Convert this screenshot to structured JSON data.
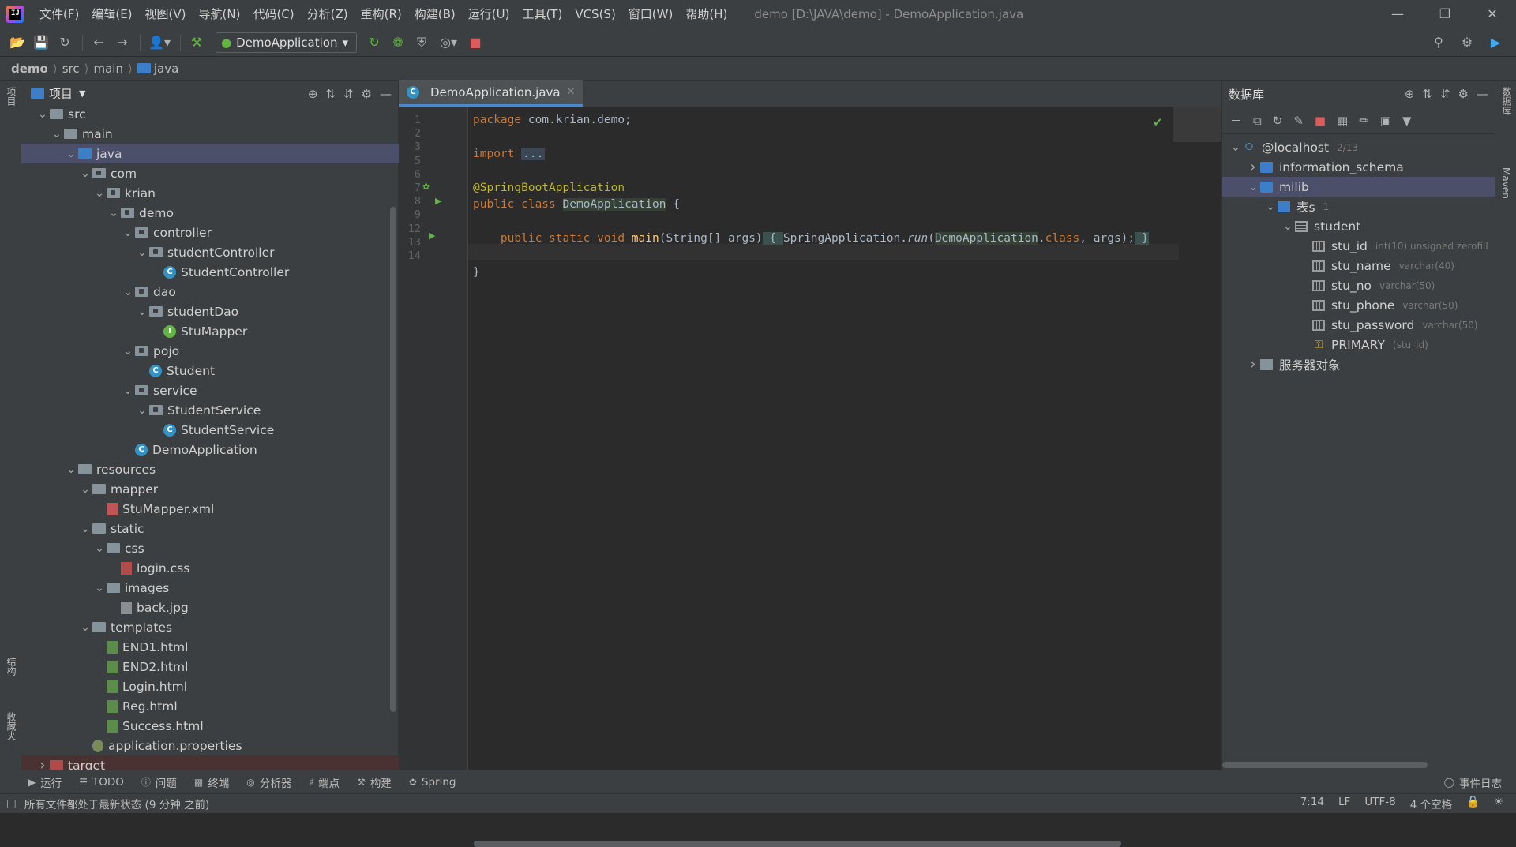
{
  "app": {
    "logo_text": "IJ",
    "menus": [
      "文件(F)",
      "编辑(E)",
      "视图(V)",
      "导航(N)",
      "代码(C)",
      "分析(Z)",
      "重构(R)",
      "构建(B)",
      "运行(U)",
      "工具(T)",
      "VCS(S)",
      "窗口(W)",
      "帮助(H)"
    ],
    "window_title": "demo [D:\\JAVA\\demo] - DemoApplication.java",
    "win_controls": {
      "minimize": "—",
      "restore": "❐",
      "close": "✕"
    }
  },
  "toolbar": {
    "run_config": "DemoApplication"
  },
  "breadcrumb": [
    "demo",
    "src",
    "main",
    "java"
  ],
  "left_stripe": {
    "project_tab": "项目",
    "structure_tab": "结构",
    "favorites_tab": "收藏夹"
  },
  "right_stripe": {
    "database_tab": "数据库",
    "maven_tab": "Maven"
  },
  "project_panel": {
    "title": "项目",
    "tree": [
      {
        "label": "src",
        "depth": 1,
        "expanded": true,
        "icon": "folder"
      },
      {
        "label": "main",
        "depth": 2,
        "expanded": true,
        "icon": "folder"
      },
      {
        "label": "java",
        "depth": 3,
        "expanded": true,
        "icon": "folder-blue",
        "selected": true
      },
      {
        "label": "com",
        "depth": 4,
        "expanded": true,
        "icon": "package"
      },
      {
        "label": "krian",
        "depth": 5,
        "expanded": true,
        "icon": "package"
      },
      {
        "label": "demo",
        "depth": 6,
        "expanded": true,
        "icon": "package"
      },
      {
        "label": "controller",
        "depth": 7,
        "expanded": true,
        "icon": "package"
      },
      {
        "label": "studentController",
        "depth": 8,
        "expanded": true,
        "icon": "package"
      },
      {
        "label": "StudentController",
        "depth": 9,
        "icon": "class"
      },
      {
        "label": "dao",
        "depth": 7,
        "expanded": true,
        "icon": "package"
      },
      {
        "label": "studentDao",
        "depth": 8,
        "expanded": true,
        "icon": "package"
      },
      {
        "label": "StuMapper",
        "depth": 9,
        "icon": "interface"
      },
      {
        "label": "pojo",
        "depth": 7,
        "expanded": true,
        "icon": "package"
      },
      {
        "label": "Student",
        "depth": 8,
        "icon": "class"
      },
      {
        "label": "service",
        "depth": 7,
        "expanded": true,
        "icon": "package"
      },
      {
        "label": "StudentService",
        "depth": 8,
        "expanded": true,
        "icon": "package"
      },
      {
        "label": "StudentService",
        "depth": 9,
        "icon": "class"
      },
      {
        "label": "DemoApplication",
        "depth": 7,
        "icon": "spring-class"
      },
      {
        "label": "resources",
        "depth": 3,
        "expanded": true,
        "icon": "folder-res"
      },
      {
        "label": "mapper",
        "depth": 4,
        "expanded": true,
        "icon": "folder"
      },
      {
        "label": "StuMapper.xml",
        "depth": 5,
        "icon": "xml"
      },
      {
        "label": "static",
        "depth": 4,
        "expanded": true,
        "icon": "folder"
      },
      {
        "label": "css",
        "depth": 5,
        "expanded": true,
        "icon": "folder"
      },
      {
        "label": "login.css",
        "depth": 6,
        "icon": "css"
      },
      {
        "label": "images",
        "depth": 5,
        "expanded": true,
        "icon": "folder"
      },
      {
        "label": "back.jpg",
        "depth": 6,
        "icon": "img"
      },
      {
        "label": "templates",
        "depth": 4,
        "expanded": true,
        "icon": "folder"
      },
      {
        "label": "END1.html",
        "depth": 5,
        "icon": "html"
      },
      {
        "label": "END2.html",
        "depth": 5,
        "icon": "html"
      },
      {
        "label": "Login.html",
        "depth": 5,
        "icon": "html"
      },
      {
        "label": "Reg.html",
        "depth": 5,
        "icon": "html"
      },
      {
        "label": "Success.html",
        "depth": 5,
        "icon": "html"
      },
      {
        "label": "application.properties",
        "depth": 4,
        "icon": "props"
      },
      {
        "label": "target",
        "depth": 1,
        "expanded": false,
        "icon": "folder-excluded",
        "excluded": true
      }
    ]
  },
  "editor": {
    "tab_label": "DemoApplication.java",
    "line_numbers": [
      "1",
      "2",
      "3",
      "5",
      "6",
      "7",
      "8",
      "9",
      "12",
      "13",
      "14"
    ]
  },
  "database_panel": {
    "title": "数据库",
    "tree": [
      {
        "label": "@localhost",
        "meta": "2/13",
        "depth": 0,
        "expanded": true,
        "icon": "host"
      },
      {
        "label": "information_schema",
        "meta": "",
        "depth": 1,
        "expanded": false,
        "icon": "schema"
      },
      {
        "label": "milib",
        "meta": "",
        "depth": 1,
        "expanded": true,
        "icon": "schema",
        "selected": true
      },
      {
        "label": "表s",
        "meta": "1",
        "depth": 2,
        "expanded": true,
        "icon": "folderb"
      },
      {
        "label": "student",
        "meta": "",
        "depth": 3,
        "expanded": true,
        "icon": "table"
      },
      {
        "label": "stu_id",
        "meta": "int(10) unsigned zerofill",
        "depth": 4,
        "icon": "col"
      },
      {
        "label": "stu_name",
        "meta": "varchar(40)",
        "depth": 4,
        "icon": "col"
      },
      {
        "label": "stu_no",
        "meta": "varchar(50)",
        "depth": 4,
        "icon": "col"
      },
      {
        "label": "stu_phone",
        "meta": "varchar(50)",
        "depth": 4,
        "icon": "col"
      },
      {
        "label": "stu_password",
        "meta": "varchar(50)",
        "depth": 4,
        "icon": "col"
      },
      {
        "label": "PRIMARY",
        "meta": "(stu_id)",
        "depth": 4,
        "icon": "key"
      },
      {
        "label": "服务器对象",
        "meta": "",
        "depth": 1,
        "expanded": false,
        "icon": "folder"
      }
    ]
  },
  "toolstrip": [
    "运行",
    "TODO",
    "问题",
    "终端",
    "分析器",
    "端点",
    "构建",
    "Spring"
  ],
  "toolstrip_right": "事件日志",
  "status": {
    "message": "所有文件都处于最新状态 (9 分钟 之前)",
    "position": "7:14",
    "line_sep": "LF",
    "encoding": "UTF-8",
    "indent": "4 个空格"
  },
  "colors": {
    "accent": "#4a88c7",
    "selection": "#4b4f6a",
    "keyword": "#cc7832",
    "annotation": "#bbb529"
  }
}
